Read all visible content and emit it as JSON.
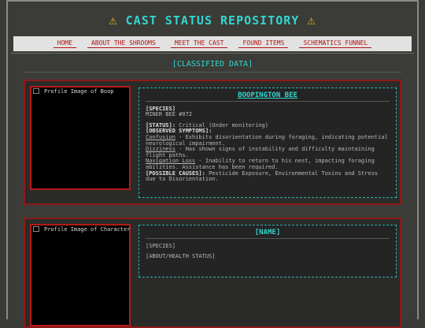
{
  "header": {
    "warn_left": "⚠",
    "title": "CAST STATUS REPOSITORY",
    "warn_right": "⚠"
  },
  "nav": {
    "items": [
      "HOME",
      "ABOUT THE SHROOMS",
      "MEET THE CAST",
      "FOUND ITEMS",
      "SCHEMATICS FUNNEL"
    ]
  },
  "section_heading": "[CLASSIFIED DATA]",
  "profiles": [
    {
      "image_alt": "Profile Image of Boop",
      "name": "BOOPINGTON BEE",
      "species_label": "[SPECIES]",
      "species": "MINER BEE #072",
      "status_label": "[STATUS]:",
      "status": "Critical (Under monitoring)",
      "symptoms_label": "[OBSERVED SYMPTOMS]:",
      "symptoms": [
        {
          "term": "Confusion",
          "desc": " - Exhibits disorientation during foraging, indicating potential neurological impairment."
        },
        {
          "term": "Dizziness",
          "desc": " - Has shown signs of instability and difficulty maintaining flight paths."
        },
        {
          "term": "Navigation Loss",
          "desc": " - Inability to return to his nest, impacting foraging abilities. Assistance has been required."
        }
      ],
      "causes_label": "[POSSIBLE CAUSES]:",
      "causes": "Pesticide Exposure, Environmental Toxins and Stress due to Disorientation."
    },
    {
      "image_alt": "Profile Image of Character",
      "name": "[NAME]",
      "species": "[SPECIES]",
      "about": "[ABOUT/HEALTH STATUS]"
    }
  ]
}
